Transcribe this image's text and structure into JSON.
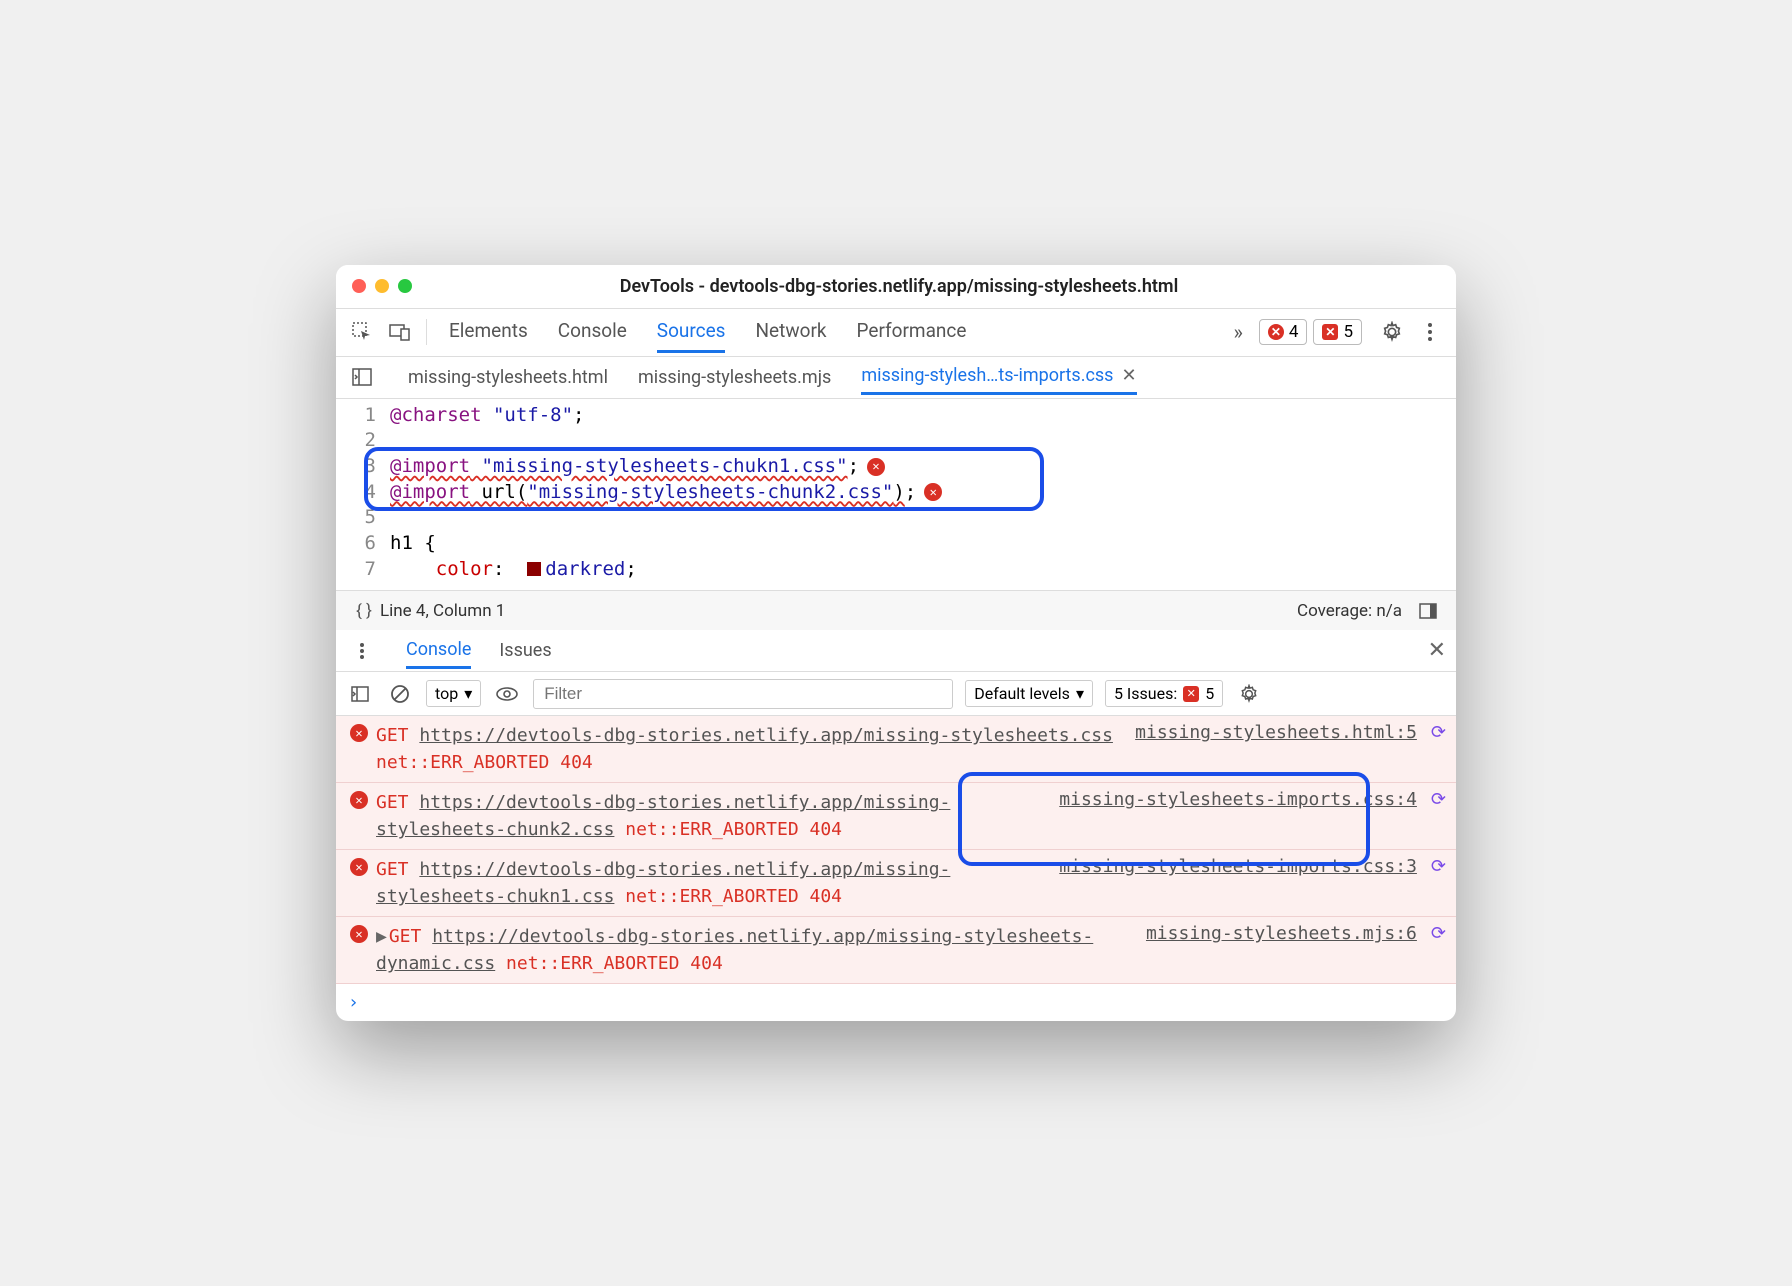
{
  "title": "DevTools - devtools-dbg-stories.netlify.app/missing-stylesheets.html",
  "mainTabs": [
    "Elements",
    "Console",
    "Sources",
    "Network",
    "Performance"
  ],
  "mainTabActive": 2,
  "errorCount": "4",
  "warnCount": "5",
  "fileTabs": [
    "missing-stylesheets.html",
    "missing-stylesheets.mjs",
    "missing-stylesh…ts-imports.css"
  ],
  "fileTabActive": 2,
  "code": {
    "l1a": "@charset",
    "l1b": " \"utf-8\"",
    "l1c": ";",
    "l3a": "@import",
    "l3b": " \"missing-stylesheets-chukn1.css\"",
    "l3c": ";",
    "l4a": "@import",
    "l4b": " url(",
    "l4c": "\"missing-stylesheets-chunk2.css\"",
    "l4d": ")",
    "l4e": ";",
    "l6": "h1 {",
    "l7a": "    ",
    "l7b": "color",
    "l7c": ":  ",
    "l7d": "darkred",
    "l7e": ";"
  },
  "status": {
    "pos": "Line 4, Column 1",
    "cov": "Coverage: n/a"
  },
  "drawerTabs": [
    "Console",
    "Issues"
  ],
  "drawerActive": 0,
  "consoleTb": {
    "context": "top",
    "filterPh": "Filter",
    "levels": "Default levels",
    "issues": "5 Issues:",
    "issuesN": "5"
  },
  "rows": [
    {
      "m1": "GET ",
      "u": "https://devtools-dbg-stories.netlify.app/missing-stylesheets.css",
      "m2": " net::ERR_ABORTED 404",
      "s": "missing-stylesheets.html:5"
    },
    {
      "m1": "GET ",
      "u": "https://devtools-dbg-stories.netlify.app/missing-stylesheets-chunk2.css",
      "m2": " net::ERR_ABORTED 404",
      "s": "missing-stylesheets-imports.css:4"
    },
    {
      "m1": "GET ",
      "u": "https://devtools-dbg-stories.netlify.app/missing-stylesheets-chukn1.css",
      "m2": " net::ERR_ABORTED 404",
      "s": "missing-stylesheets-imports.css:3"
    },
    {
      "m1": "GET ",
      "u": "https://devtools-dbg-stories.netlify.app/missing-stylesheets-dynamic.css",
      "m2": " net::ERR_ABORTED 404",
      "s": "missing-stylesheets.mjs:6",
      "tri": true
    }
  ]
}
